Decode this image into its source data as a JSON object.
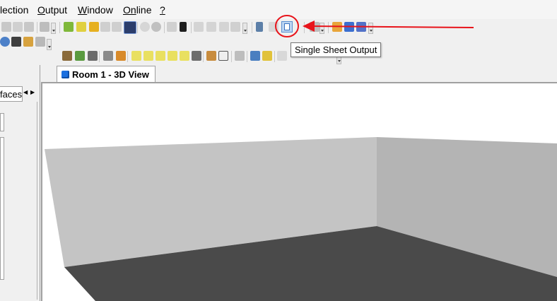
{
  "menu": {
    "items": [
      {
        "label": "lection",
        "accel": ""
      },
      {
        "label": "utput",
        "accel": "O"
      },
      {
        "label": "indow",
        "accel": "W"
      },
      {
        "label": "line",
        "accel": "On"
      },
      {
        "label": "?",
        "accel": ""
      }
    ]
  },
  "tooltip": {
    "text": "Single Sheet Output"
  },
  "left_panel": {
    "tab_label": "faces"
  },
  "view_tab": {
    "label": "Room 1 - 3D View"
  },
  "colors": {
    "annotation_red": "#e8141b",
    "back_wall": "#c4c4c4",
    "side_wall": "#b4b4b4",
    "floor": "#4a4a4a",
    "tab_icon": "#1a6fe0"
  }
}
